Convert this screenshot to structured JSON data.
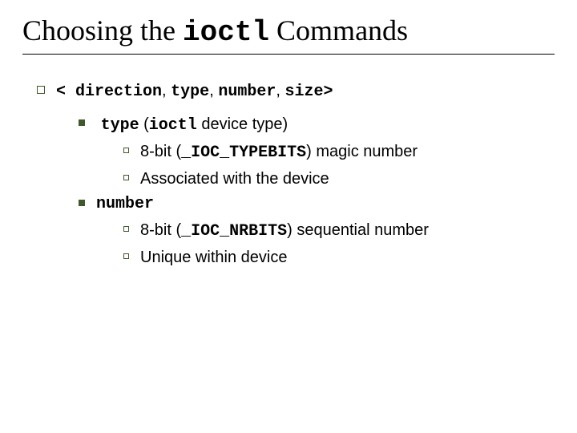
{
  "title": {
    "pre": "Choosing the ",
    "code": "ioctl",
    "post": " Commands"
  },
  "b1": {
    "open": "< ",
    "direction": "direction",
    "c1": ", ",
    "type": "type",
    "c2": ", ",
    "number": "number",
    "c3": ", ",
    "size": "size",
    "close": ">"
  },
  "type_item": {
    "label_code": "type",
    "open": " (",
    "ioctl": "ioctl",
    "tail": " device type)"
  },
  "type_sub1": {
    "pre": "8-bit (",
    "macro": "_IOC_TYPEBITS",
    "post": ") magic number"
  },
  "type_sub2": "Associated with the device",
  "number_item": "number",
  "number_sub1": {
    "pre": "8-bit (",
    "macro": "_IOC_NRBITS",
    "post": ") sequential number"
  },
  "number_sub2": "Unique within device"
}
